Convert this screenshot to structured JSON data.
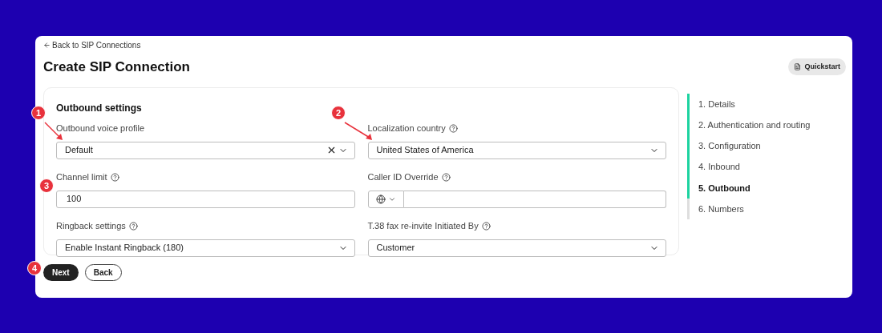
{
  "back_link": "Back to SIP Connections",
  "title": "Create SIP Connection",
  "quickstart_button": "Quickstart",
  "section_title": "Outbound settings",
  "fields": [
    {
      "kind": "select",
      "label": "Outbound voice profile",
      "help": false,
      "value": "Default",
      "clearable": true
    },
    {
      "kind": "select",
      "label": "Localization country",
      "help": true,
      "value": "United States of America",
      "clearable": false
    },
    {
      "kind": "input",
      "label": "Channel limit",
      "help": true,
      "value": "100"
    },
    {
      "kind": "phone",
      "label": "Caller ID Override",
      "help": true
    },
    {
      "kind": "select",
      "label": "Ringback settings",
      "help": true,
      "value": "Enable Instant Ringback (180)",
      "clearable": false
    },
    {
      "kind": "select",
      "label": "T.38 fax re-invite Initiated By",
      "help": true,
      "value": "Customer",
      "clearable": false
    }
  ],
  "buttons": [
    {
      "label": "Next",
      "kind": "primary"
    },
    {
      "label": "Back",
      "kind": "secondary"
    }
  ],
  "steps": [
    {
      "label": "1. Details",
      "done": true,
      "selected": false
    },
    {
      "label": "2. Authentication and routing",
      "done": true,
      "selected": false
    },
    {
      "label": "3. Configuration",
      "done": true,
      "selected": false
    },
    {
      "label": "4. Inbound",
      "done": true,
      "selected": false
    },
    {
      "label": "5. Outbound",
      "done": true,
      "selected": true
    },
    {
      "label": "6. Numbers",
      "done": false,
      "selected": false
    }
  ],
  "annotations": [
    {
      "label": "1",
      "arrow": true
    },
    {
      "label": "2",
      "arrow": true
    },
    {
      "label": "3",
      "arrow": false
    },
    {
      "label": "4",
      "arrow": false
    }
  ]
}
